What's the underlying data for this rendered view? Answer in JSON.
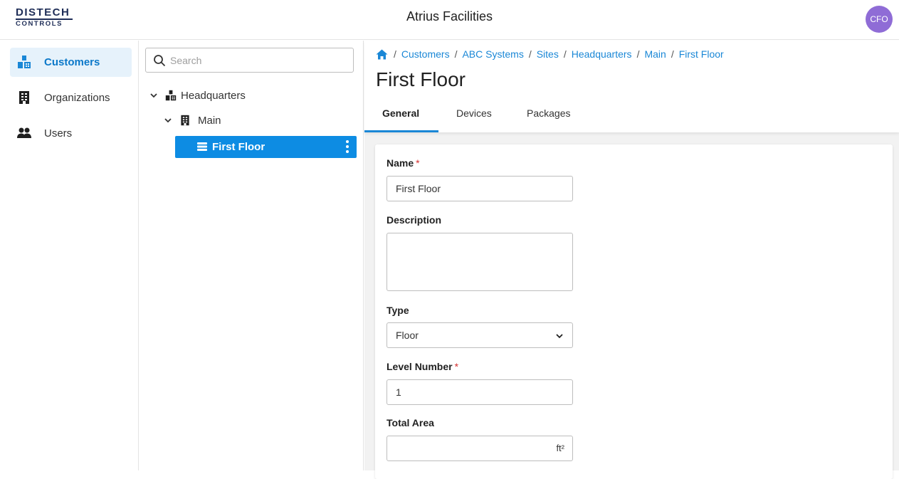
{
  "header": {
    "logo_line1": "DISTECH",
    "logo_line2": "CONTROLS",
    "title": "Atrius Facilities",
    "avatar_initials": "CFO",
    "avatar_color": "#8f6cd6"
  },
  "nav": {
    "items": [
      {
        "label": "Customers",
        "icon": "customers-icon",
        "active": true
      },
      {
        "label": "Organizations",
        "icon": "building-icon",
        "active": false
      },
      {
        "label": "Users",
        "icon": "users-icon",
        "active": false
      }
    ]
  },
  "tree": {
    "search_placeholder": "Search",
    "nodes": [
      {
        "label": "Headquarters",
        "icon": "site-icon",
        "expanded": true
      },
      {
        "label": "Main",
        "icon": "building-icon",
        "expanded": true
      },
      {
        "label": "First Floor",
        "icon": "floor-icon",
        "selected": true
      }
    ]
  },
  "breadcrumb": {
    "items": [
      "Customers",
      "ABC Systems",
      "Sites",
      "Headquarters",
      "Main",
      "First Floor"
    ]
  },
  "page": {
    "title": "First Floor"
  },
  "tabs": [
    {
      "label": "General",
      "active": true
    },
    {
      "label": "Devices",
      "active": false
    },
    {
      "label": "Packages",
      "active": false
    }
  ],
  "form": {
    "name_label": "Name",
    "name_value": "First Floor",
    "description_label": "Description",
    "description_value": "",
    "type_label": "Type",
    "type_value": "Floor",
    "level_label": "Level Number",
    "level_value": "1",
    "area_label": "Total Area",
    "area_value": "",
    "area_unit": "ft²",
    "required_mark": "*"
  },
  "colors": {
    "accent": "#1a87d6",
    "selected": "#0d8ce3",
    "required": "#d32f2f"
  }
}
